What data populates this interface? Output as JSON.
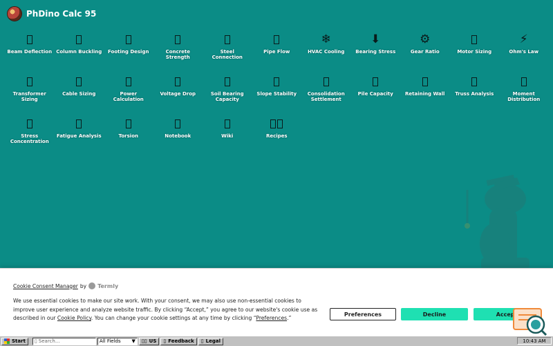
{
  "header": {
    "title": "PhDino Calc 95"
  },
  "desktop": {
    "icons": [
      {
        "label": "Beam Deflection",
        "glyph": "□"
      },
      {
        "label": "Column Buckling",
        "glyph": "□"
      },
      {
        "label": "Footing Design",
        "glyph": "□"
      },
      {
        "label": "Concrete Strength",
        "glyph": "□"
      },
      {
        "label": "Steel Connection",
        "glyph": "□"
      },
      {
        "label": "Pipe Flow",
        "glyph": "□"
      },
      {
        "label": "HVAC Cooling",
        "glyph": "❄"
      },
      {
        "label": "Bearing Stress",
        "glyph": "⬇"
      },
      {
        "label": "Gear Ratio",
        "glyph": "⚙"
      },
      {
        "label": "Motor Sizing",
        "glyph": "□"
      },
      {
        "label": "Ohm's Law",
        "glyph": "⚡"
      },
      {
        "label": "Transformer Sizing",
        "glyph": "□"
      },
      {
        "label": "Cable Sizing",
        "glyph": "□"
      },
      {
        "label": "Power Calculation",
        "glyph": "□"
      },
      {
        "label": "Voltage Drop",
        "glyph": "□"
      },
      {
        "label": "Soil Bearing Capacity",
        "glyph": "□"
      },
      {
        "label": "Slope Stability",
        "glyph": "□"
      },
      {
        "label": "Consolidation Settlement",
        "glyph": "□"
      },
      {
        "label": "Pile Capacity",
        "glyph": "□"
      },
      {
        "label": "Retaining Wall",
        "glyph": "□"
      },
      {
        "label": "Truss Analysis",
        "glyph": "□"
      },
      {
        "label": "Moment Distribution",
        "glyph": "□"
      },
      {
        "label": "Stress Concentration",
        "glyph": "□"
      },
      {
        "label": "Fatigue Analysis",
        "glyph": "□"
      },
      {
        "label": "Torsion",
        "glyph": "□"
      },
      {
        "label": "Notebook",
        "glyph": "□"
      },
      {
        "label": "Wiki",
        "glyph": "□"
      },
      {
        "label": "Recipes",
        "glyph": "□□"
      }
    ]
  },
  "cookie": {
    "heading": "Cookie Consent Manager",
    "by": "by",
    "brand": "Termly",
    "text_1": "We use essential cookies to make our site work. With your consent, we may also use non-essential cookies to improve user experience and analyze website traffic. By clicking “Accept,” you agree to our website's cookie use as described in our ",
    "policy_link": "Cookie Policy",
    "text_2": ". You can change your cookie settings at any time by clicking “",
    "preferences_link": "Preferences",
    "text_3": ".”",
    "buttons": {
      "preferences": "Preferences",
      "decline": "Decline",
      "accept": "Accept"
    }
  },
  "taskbar": {
    "start": "Start",
    "search_placeholder": "Search...",
    "filter": "All Fields",
    "locale": "US",
    "feedback": "Feedback",
    "legal": "Legal",
    "clock": "10:43 AM"
  },
  "colors": {
    "desktop": "#0b8c86",
    "accent": "#1fe0b2",
    "taskbar": "#c0c0c0"
  }
}
